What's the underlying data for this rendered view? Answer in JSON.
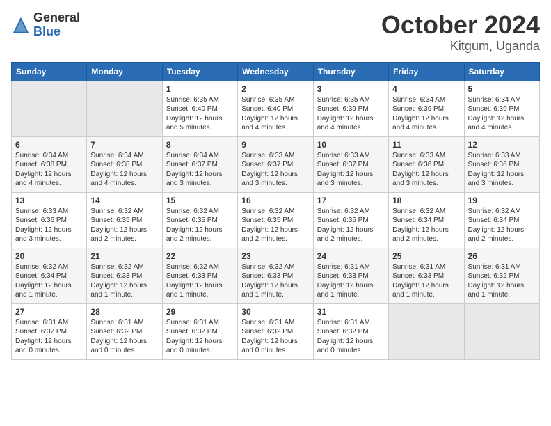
{
  "logo": {
    "general": "General",
    "blue": "Blue"
  },
  "title": {
    "month": "October 2024",
    "location": "Kitgum, Uganda"
  },
  "weekdays": [
    "Sunday",
    "Monday",
    "Tuesday",
    "Wednesday",
    "Thursday",
    "Friday",
    "Saturday"
  ],
  "weeks": [
    [
      {
        "day": "",
        "sunrise": "",
        "sunset": "",
        "daylight": ""
      },
      {
        "day": "",
        "sunrise": "",
        "sunset": "",
        "daylight": ""
      },
      {
        "day": "1",
        "sunrise": "Sunrise: 6:35 AM",
        "sunset": "Sunset: 6:40 PM",
        "daylight": "Daylight: 12 hours and 5 minutes."
      },
      {
        "day": "2",
        "sunrise": "Sunrise: 6:35 AM",
        "sunset": "Sunset: 6:40 PM",
        "daylight": "Daylight: 12 hours and 4 minutes."
      },
      {
        "day": "3",
        "sunrise": "Sunrise: 6:35 AM",
        "sunset": "Sunset: 6:39 PM",
        "daylight": "Daylight: 12 hours and 4 minutes."
      },
      {
        "day": "4",
        "sunrise": "Sunrise: 6:34 AM",
        "sunset": "Sunset: 6:39 PM",
        "daylight": "Daylight: 12 hours and 4 minutes."
      },
      {
        "day": "5",
        "sunrise": "Sunrise: 6:34 AM",
        "sunset": "Sunset: 6:39 PM",
        "daylight": "Daylight: 12 hours and 4 minutes."
      }
    ],
    [
      {
        "day": "6",
        "sunrise": "Sunrise: 6:34 AM",
        "sunset": "Sunset: 6:38 PM",
        "daylight": "Daylight: 12 hours and 4 minutes."
      },
      {
        "day": "7",
        "sunrise": "Sunrise: 6:34 AM",
        "sunset": "Sunset: 6:38 PM",
        "daylight": "Daylight: 12 hours and 4 minutes."
      },
      {
        "day": "8",
        "sunrise": "Sunrise: 6:34 AM",
        "sunset": "Sunset: 6:37 PM",
        "daylight": "Daylight: 12 hours and 3 minutes."
      },
      {
        "day": "9",
        "sunrise": "Sunrise: 6:33 AM",
        "sunset": "Sunset: 6:37 PM",
        "daylight": "Daylight: 12 hours and 3 minutes."
      },
      {
        "day": "10",
        "sunrise": "Sunrise: 6:33 AM",
        "sunset": "Sunset: 6:37 PM",
        "daylight": "Daylight: 12 hours and 3 minutes."
      },
      {
        "day": "11",
        "sunrise": "Sunrise: 6:33 AM",
        "sunset": "Sunset: 6:36 PM",
        "daylight": "Daylight: 12 hours and 3 minutes."
      },
      {
        "day": "12",
        "sunrise": "Sunrise: 6:33 AM",
        "sunset": "Sunset: 6:36 PM",
        "daylight": "Daylight: 12 hours and 3 minutes."
      }
    ],
    [
      {
        "day": "13",
        "sunrise": "Sunrise: 6:33 AM",
        "sunset": "Sunset: 6:36 PM",
        "daylight": "Daylight: 12 hours and 3 minutes."
      },
      {
        "day": "14",
        "sunrise": "Sunrise: 6:32 AM",
        "sunset": "Sunset: 6:35 PM",
        "daylight": "Daylight: 12 hours and 2 minutes."
      },
      {
        "day": "15",
        "sunrise": "Sunrise: 6:32 AM",
        "sunset": "Sunset: 6:35 PM",
        "daylight": "Daylight: 12 hours and 2 minutes."
      },
      {
        "day": "16",
        "sunrise": "Sunrise: 6:32 AM",
        "sunset": "Sunset: 6:35 PM",
        "daylight": "Daylight: 12 hours and 2 minutes."
      },
      {
        "day": "17",
        "sunrise": "Sunrise: 6:32 AM",
        "sunset": "Sunset: 6:35 PM",
        "daylight": "Daylight: 12 hours and 2 minutes."
      },
      {
        "day": "18",
        "sunrise": "Sunrise: 6:32 AM",
        "sunset": "Sunset: 6:34 PM",
        "daylight": "Daylight: 12 hours and 2 minutes."
      },
      {
        "day": "19",
        "sunrise": "Sunrise: 6:32 AM",
        "sunset": "Sunset: 6:34 PM",
        "daylight": "Daylight: 12 hours and 2 minutes."
      }
    ],
    [
      {
        "day": "20",
        "sunrise": "Sunrise: 6:32 AM",
        "sunset": "Sunset: 6:34 PM",
        "daylight": "Daylight: 12 hours and 1 minute."
      },
      {
        "day": "21",
        "sunrise": "Sunrise: 6:32 AM",
        "sunset": "Sunset: 6:33 PM",
        "daylight": "Daylight: 12 hours and 1 minute."
      },
      {
        "day": "22",
        "sunrise": "Sunrise: 6:32 AM",
        "sunset": "Sunset: 6:33 PM",
        "daylight": "Daylight: 12 hours and 1 minute."
      },
      {
        "day": "23",
        "sunrise": "Sunrise: 6:32 AM",
        "sunset": "Sunset: 6:33 PM",
        "daylight": "Daylight: 12 hours and 1 minute."
      },
      {
        "day": "24",
        "sunrise": "Sunrise: 6:31 AM",
        "sunset": "Sunset: 6:33 PM",
        "daylight": "Daylight: 12 hours and 1 minute."
      },
      {
        "day": "25",
        "sunrise": "Sunrise: 6:31 AM",
        "sunset": "Sunset: 6:33 PM",
        "daylight": "Daylight: 12 hours and 1 minute."
      },
      {
        "day": "26",
        "sunrise": "Sunrise: 6:31 AM",
        "sunset": "Sunset: 6:32 PM",
        "daylight": "Daylight: 12 hours and 1 minute."
      }
    ],
    [
      {
        "day": "27",
        "sunrise": "Sunrise: 6:31 AM",
        "sunset": "Sunset: 6:32 PM",
        "daylight": "Daylight: 12 hours and 0 minutes."
      },
      {
        "day": "28",
        "sunrise": "Sunrise: 6:31 AM",
        "sunset": "Sunset: 6:32 PM",
        "daylight": "Daylight: 12 hours and 0 minutes."
      },
      {
        "day": "29",
        "sunrise": "Sunrise: 6:31 AM",
        "sunset": "Sunset: 6:32 PM",
        "daylight": "Daylight: 12 hours and 0 minutes."
      },
      {
        "day": "30",
        "sunrise": "Sunrise: 6:31 AM",
        "sunset": "Sunset: 6:32 PM",
        "daylight": "Daylight: 12 hours and 0 minutes."
      },
      {
        "day": "31",
        "sunrise": "Sunrise: 6:31 AM",
        "sunset": "Sunset: 6:32 PM",
        "daylight": "Daylight: 12 hours and 0 minutes."
      },
      {
        "day": "",
        "sunrise": "",
        "sunset": "",
        "daylight": ""
      },
      {
        "day": "",
        "sunrise": "",
        "sunset": "",
        "daylight": ""
      }
    ]
  ]
}
